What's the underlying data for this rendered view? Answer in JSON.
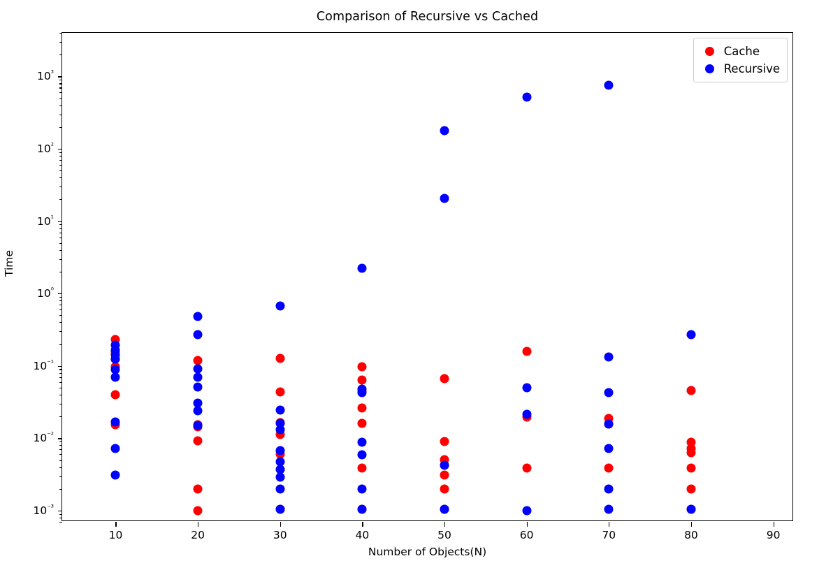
{
  "chart_data": {
    "type": "scatter",
    "title": "Comparison of Recursive vs Cached",
    "xlabel": "Number of Objects(N)",
    "ylabel": "Time",
    "xscale": "linear",
    "yscale": "log",
    "xlim": [
      3.5,
      92.5
    ],
    "ylim": [
      0.0007,
      4000
    ],
    "grid": false,
    "legend_position": "upper right",
    "xticks": [
      10,
      20,
      30,
      40,
      50,
      60,
      70,
      80,
      90
    ],
    "xtick_labels": [
      "10",
      "20",
      "30",
      "40",
      "50",
      "60",
      "70",
      "80",
      "90"
    ],
    "yticks": [
      0.001,
      0.01,
      0.1,
      1,
      10,
      100,
      1000
    ],
    "ytick_labels": [
      "10⁻³",
      "10⁻²",
      "10⁻¹",
      "10⁰",
      "10¹",
      "10²",
      "10³"
    ],
    "colors": {
      "cache": "#ff0000",
      "recursive": "#0000ff"
    },
    "series": [
      {
        "name": "Cache",
        "color": "#ff0000",
        "points": [
          [
            10,
            0.23
          ],
          [
            10,
            0.155
          ],
          [
            10,
            0.125
          ],
          [
            10,
            0.097
          ],
          [
            10,
            0.04
          ],
          [
            10,
            0.0155
          ],
          [
            20,
            0.118
          ],
          [
            20,
            0.0155
          ],
          [
            20,
            0.0145
          ],
          [
            20,
            0.0092
          ],
          [
            20,
            0.002
          ],
          [
            20,
            0.001
          ],
          [
            30,
            0.128
          ],
          [
            30,
            0.0435
          ],
          [
            30,
            0.0165
          ],
          [
            30,
            0.0112
          ],
          [
            30,
            0.0061
          ],
          [
            30,
            0.00105
          ],
          [
            40,
            0.097
          ],
          [
            40,
            0.064
          ],
          [
            40,
            0.0455
          ],
          [
            40,
            0.0265
          ],
          [
            40,
            0.0162
          ],
          [
            40,
            0.0039
          ],
          [
            40,
            0.00105
          ],
          [
            50,
            0.067
          ],
          [
            50,
            0.0091
          ],
          [
            50,
            0.0051
          ],
          [
            50,
            0.0042
          ],
          [
            50,
            0.0031
          ],
          [
            50,
            0.002
          ],
          [
            50,
            0.00105
          ],
          [
            60,
            0.158
          ],
          [
            60,
            0.0197
          ],
          [
            60,
            0.0039
          ],
          [
            70,
            0.0188
          ],
          [
            70,
            0.0158
          ],
          [
            70,
            0.0039
          ],
          [
            80,
            0.0455
          ],
          [
            80,
            0.0089
          ],
          [
            80,
            0.0072
          ],
          [
            80,
            0.0063
          ],
          [
            80,
            0.0039
          ],
          [
            80,
            0.002
          ],
          [
            80,
            0.00105
          ]
        ]
      },
      {
        "name": "Recursive",
        "color": "#0000ff",
        "points": [
          [
            10,
            0.192
          ],
          [
            10,
            0.167
          ],
          [
            10,
            0.143
          ],
          [
            10,
            0.125
          ],
          [
            10,
            0.089
          ],
          [
            10,
            0.069
          ],
          [
            10,
            0.0168
          ],
          [
            10,
            0.0072
          ],
          [
            10,
            0.0031
          ],
          [
            20,
            0.478
          ],
          [
            20,
            0.268
          ],
          [
            20,
            0.092
          ],
          [
            20,
            0.069
          ],
          [
            20,
            0.051
          ],
          [
            20,
            0.0305
          ],
          [
            20,
            0.0242
          ],
          [
            20,
            0.0152
          ],
          [
            30,
            0.675
          ],
          [
            30,
            0.0247
          ],
          [
            30,
            0.0162
          ],
          [
            30,
            0.0133
          ],
          [
            30,
            0.0068
          ],
          [
            30,
            0.0047
          ],
          [
            30,
            0.0037
          ],
          [
            30,
            0.0029
          ],
          [
            30,
            0.002
          ],
          [
            30,
            0.00105
          ],
          [
            40,
            2.25
          ],
          [
            40,
            0.0478
          ],
          [
            40,
            0.0432
          ],
          [
            40,
            0.0089
          ],
          [
            40,
            0.0059
          ],
          [
            40,
            0.002
          ],
          [
            40,
            0.00105
          ],
          [
            50,
            180
          ],
          [
            50,
            20.5
          ],
          [
            50,
            0.0042
          ],
          [
            50,
            0.00105
          ],
          [
            60,
            520
          ],
          [
            60,
            0.0495
          ],
          [
            60,
            0.0215
          ],
          [
            60,
            0.001
          ],
          [
            70,
            750
          ],
          [
            70,
            0.133
          ],
          [
            70,
            0.0428
          ],
          [
            70,
            0.0158
          ],
          [
            70,
            0.0072
          ],
          [
            70,
            0.002
          ],
          [
            70,
            0.00105
          ],
          [
            80,
            0.268
          ],
          [
            80,
            0.00105
          ]
        ]
      }
    ]
  },
  "legend": {
    "entries": [
      {
        "label": "Cache",
        "color": "#ff0000"
      },
      {
        "label": "Recursive",
        "color": "#0000ff"
      }
    ]
  }
}
